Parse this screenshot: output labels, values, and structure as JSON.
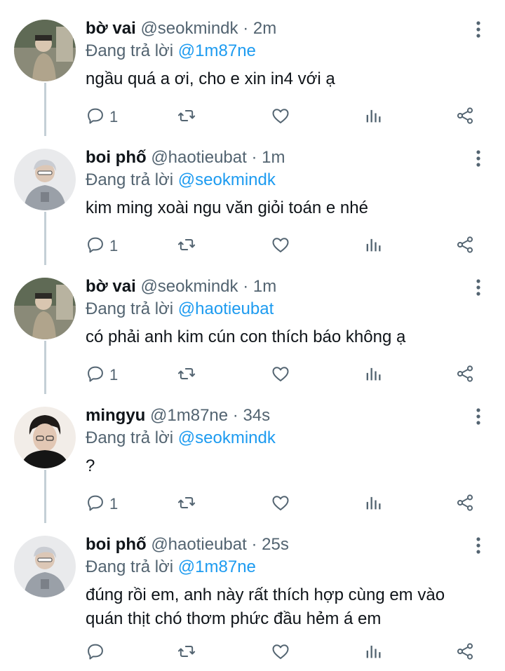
{
  "colors": {
    "accent": "#1d9bf0",
    "muted": "#536471",
    "text": "#0f1419",
    "line": "#c4cfd6"
  },
  "tweets": [
    {
      "name": "bờ vai",
      "handle": "@seokmindk",
      "separator": "·",
      "time": "2m",
      "reply_prefix": "Đang trả lời",
      "reply_to": "@1m87ne",
      "text": "ngầu quá a ơi, cho e xin in4 với ạ",
      "reply_count": "1",
      "avatar": "avatar-bovai"
    },
    {
      "name": "boi phố",
      "handle": "@haotieubat",
      "separator": "·",
      "time": "1m",
      "reply_prefix": "Đang trả lời",
      "reply_to": "@seokmindk",
      "text": "kim ming xoài ngu văn giỏi toán e nhé",
      "reply_count": "1",
      "avatar": "avatar-boipho"
    },
    {
      "name": "bờ vai",
      "handle": "@seokmindk",
      "separator": "·",
      "time": "1m",
      "reply_prefix": "Đang trả lời",
      "reply_to": "@haotieubat",
      "text": "có phải anh kim cún con thích báo không ạ",
      "reply_count": "1",
      "avatar": "avatar-bovai"
    },
    {
      "name": "mingyu",
      "handle": "@1m87ne",
      "separator": "·",
      "time": "34s",
      "reply_prefix": "Đang trả lời",
      "reply_to": "@seokmindk",
      "text": "?",
      "reply_count": "1",
      "avatar": "avatar-mingyu"
    },
    {
      "name": "boi phố",
      "handle": "@haotieubat",
      "separator": "·",
      "time": "25s",
      "reply_prefix": "Đang trả lời",
      "reply_to": "@1m87ne",
      "text": "đúng rồi em, anh này rất thích hợp cùng em vào quán thịt chó thơm phức đầu hẻm á em",
      "reply_count": "",
      "avatar": "avatar-boipho"
    }
  ]
}
